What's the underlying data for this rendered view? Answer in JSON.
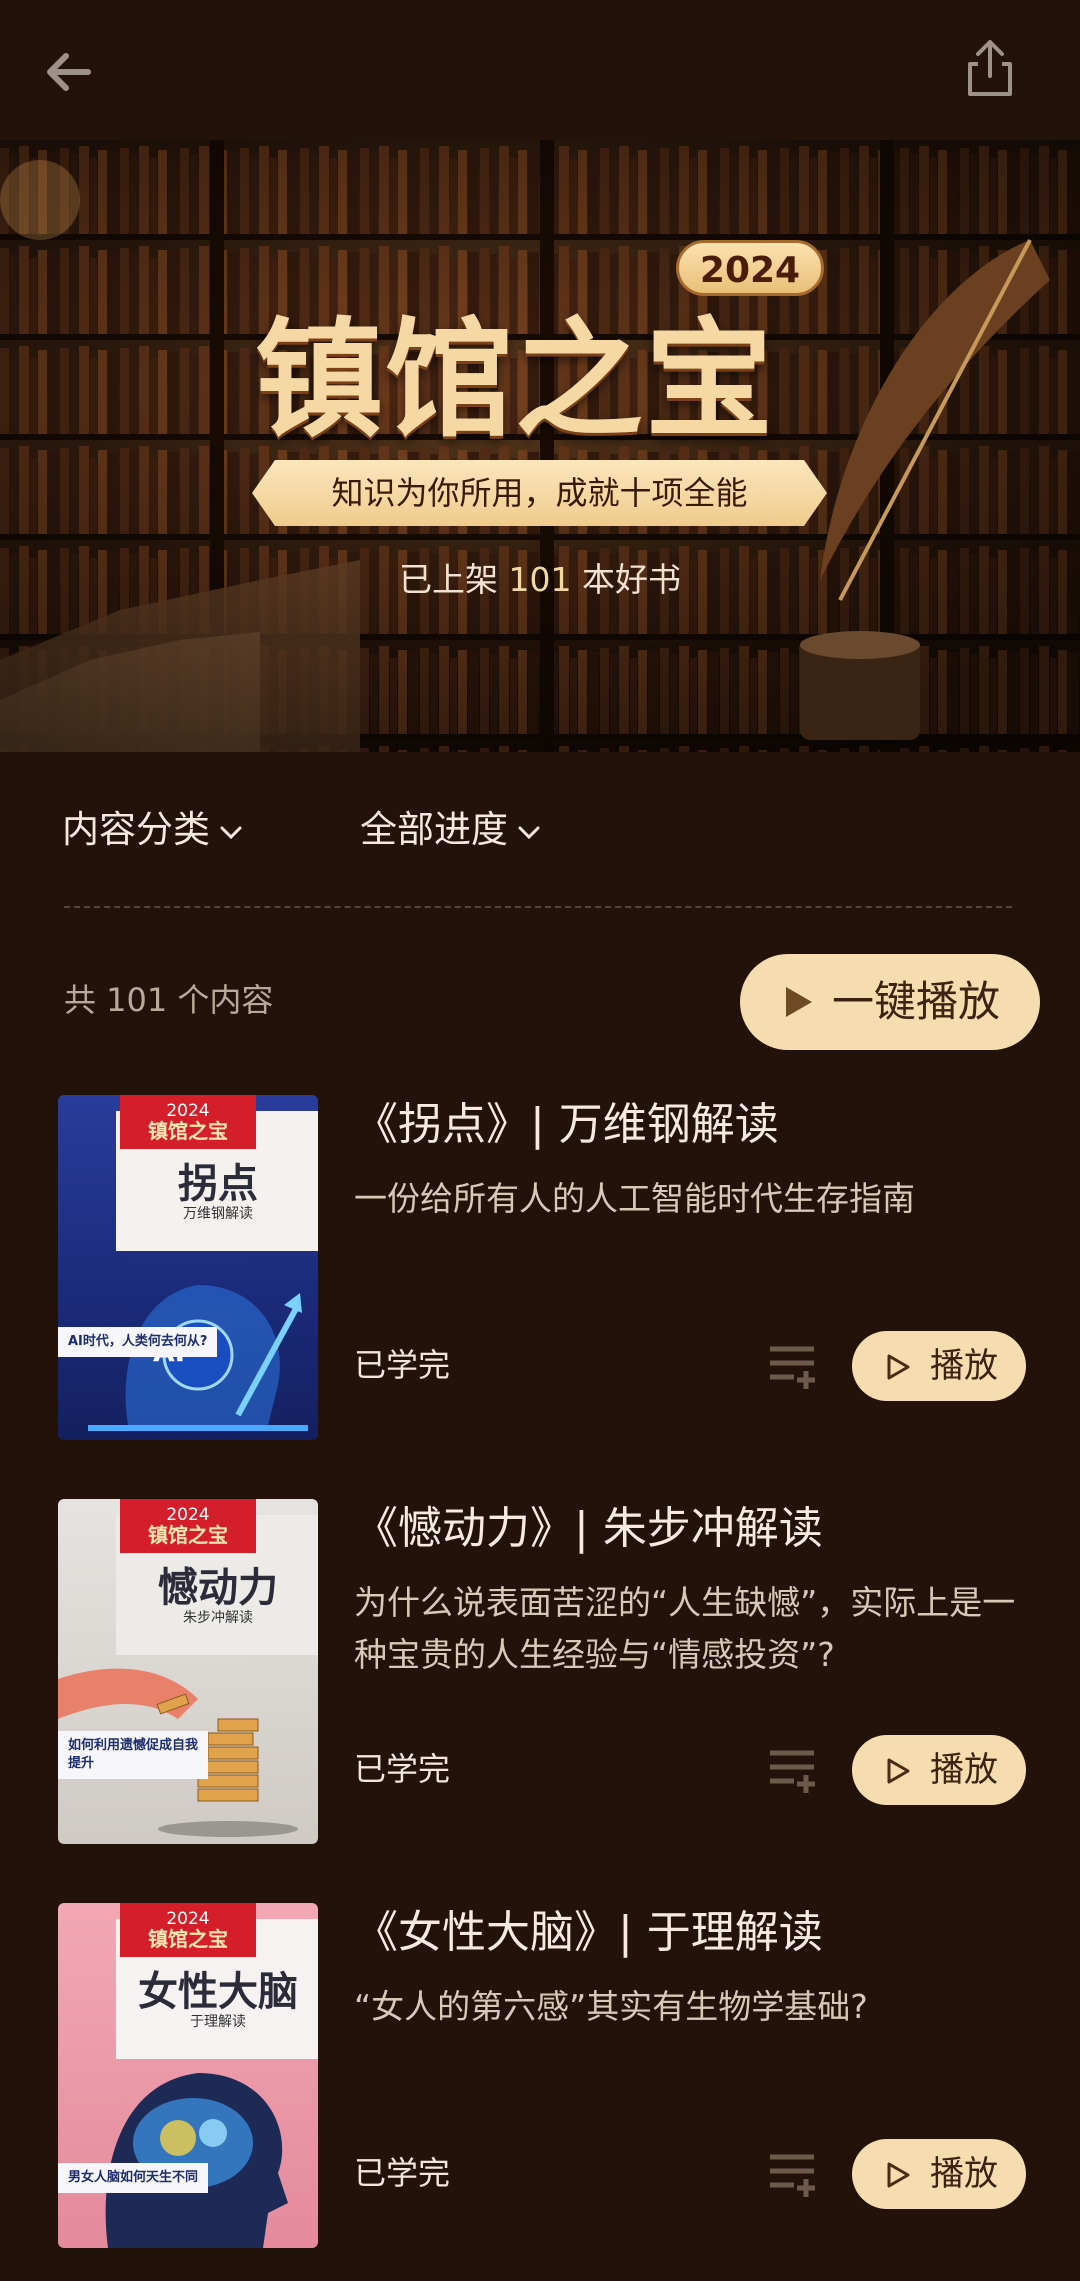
{
  "header": {
    "back_icon": "arrow-left-icon",
    "share_icon": "share-icon"
  },
  "hero": {
    "year": "2024",
    "title": "镇馆之宝",
    "ribbon": "知识为你所用，成就十项全能",
    "sub_prefix": "已上架",
    "sub_count": "101",
    "sub_suffix": "本好书"
  },
  "filters": [
    {
      "label": "内容分类"
    },
    {
      "label": "全部进度"
    }
  ],
  "summary": {
    "count_text": "共 101 个内容",
    "play_all_label": "一键播放"
  },
  "items": [
    {
      "title": "《拐点》| 万维钢解读",
      "desc": "一份给所有人的人工智能时代生存指南",
      "status": "已学完",
      "play_label": "播放",
      "cover": {
        "year": "2024",
        "brand": "镇馆之宝",
        "title": "拐点",
        "author": "万维钢解读",
        "tagline": "AI时代，人类何去何从?",
        "badge": "AI"
      }
    },
    {
      "title": "《憾动力》| 朱步冲解读",
      "desc": "为什么说表面苦涩的“人生缺憾”，实际上是一种宝贵的人生经验与“情感投资”?",
      "status": "已学完",
      "play_label": "播放",
      "cover": {
        "year": "2024",
        "brand": "镇馆之宝",
        "title": "憾动力",
        "author": "朱步冲解读",
        "tagline": "如何利用遗憾促成自我提升"
      }
    },
    {
      "title": "《女性大脑》| 于理解读",
      "desc": "“女人的第六感”其实有生物学基础?",
      "status": "已学完",
      "play_label": "播放",
      "cover": {
        "year": "2024",
        "brand": "镇馆之宝",
        "title": "女性大脑",
        "author": "于理解读",
        "tagline": "男女人脑如何天生不同"
      }
    }
  ],
  "colors": {
    "background": "#231209",
    "accent": "#f6ddb0",
    "accent_text": "#3d2312"
  }
}
